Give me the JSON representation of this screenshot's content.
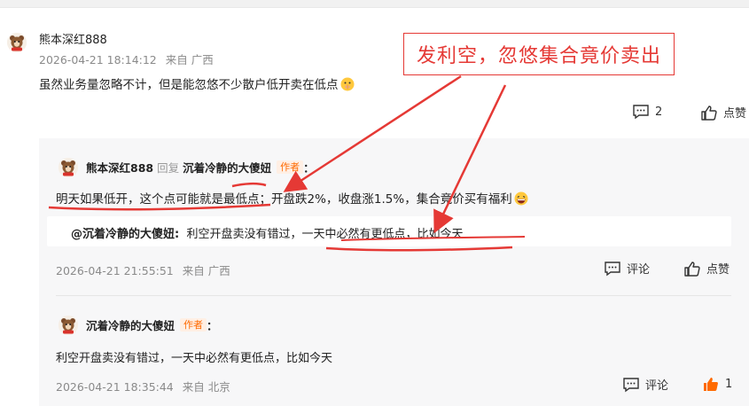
{
  "comment": {
    "username": "熊本深红888",
    "date": "2026-04-21 18:14:12",
    "location": "来自 广西",
    "text": "虽然业务量忽略不计，但是能忽悠不少散户低开卖在低点",
    "reply_count": "2",
    "like_label": "点赞"
  },
  "reply1": {
    "username": "熊本深红888",
    "reply_word": "回复",
    "target": "沉着冷静的大傻妞",
    "author_badge": "作者",
    "colon": "：",
    "text": "明天如果低开，这个点可能就是最低点；开盘跌2%，收盘涨1.5%，集合竟价买有福利",
    "quote_name": "@沉着冷静的大傻妞:",
    "quote_text": "利空开盘卖没有错过，一天中必然有更低点，比如今天",
    "date": "2026-04-21 21:55:51",
    "location": "来自 广西",
    "comment_label": "评论",
    "like_label": "点赞"
  },
  "reply2": {
    "username": "沉着冷静的大傻妞",
    "author_badge": "作者",
    "colon": "：",
    "text": "利空开盘卖没有错过，一天中必然有更低点，比如今天",
    "date": "2026-04-21 18:35:44",
    "location": "来自 北京",
    "comment_label": "评论",
    "like_count": "1"
  },
  "annotation": {
    "callout_text": "发利空，忽悠集合竟价卖出",
    "color": "#e53935"
  },
  "colors": {
    "accent_orange": "#ff6a00",
    "meta_gray": "#8a8a8a",
    "reply_bg": "#f7f7f8"
  }
}
